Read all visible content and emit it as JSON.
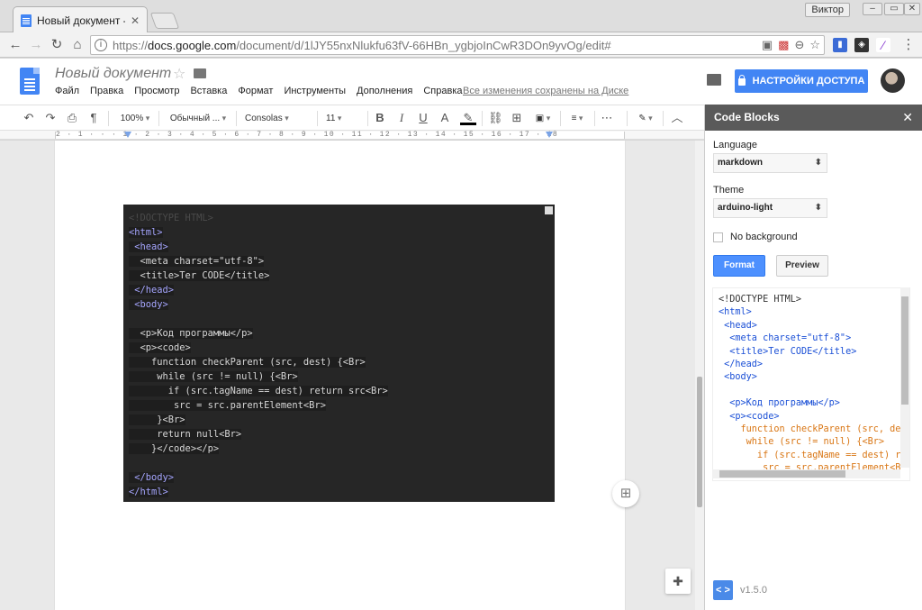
{
  "browser": {
    "tab_title": "Новый документ - ",
    "user_badge": "Виктор",
    "url_scheme": "https://",
    "url_host": "docs.google.com",
    "url_path": "/document/d/1lJY55nxNlukfu63fV-66HBn_ygbjoInCwR3DOn9yvOg/edit#"
  },
  "docs": {
    "title": "Новый документ",
    "menus": [
      "Файл",
      "Правка",
      "Просмотр",
      "Вставка",
      "Формат",
      "Инструменты",
      "Дополнения",
      "Справка"
    ],
    "saved_status": "Все изменения сохранены на Диске",
    "share_label": "НАСТРОЙКИ ДОСТУПА"
  },
  "toolbar": {
    "zoom": "100%",
    "style": "Обычный ...",
    "font": "Consolas",
    "size": "11"
  },
  "ruler": {
    "text": "2 · 1 · · · 1 · 2 · 3 · 4 · 5 · 6 · 7 · 8 · 9 · 10 · 11 · 12 · 13 · 14 · 15 · 16 · 17 · 18"
  },
  "document_code": [
    "<!DOCTYPE HTML>",
    "<html>",
    " <head>",
    "  <meta charset=\"utf-8\">",
    "  <title>Ter CODE</title>",
    " </head>",
    " <body>",
    "",
    "  <p>Код программы</p>",
    "  <p><code>",
    "    function checkParent (src, dest) {<Br>",
    "     while (src != null) {<Br>",
    "       if (src.tagName == dest) return src<Br>",
    "        src = src.parentElement<Br>",
    "     }<Br>",
    "     return null<Br>",
    "    }</code></p>",
    "",
    " </body>",
    "</html>"
  ],
  "panel": {
    "title": "Code Blocks",
    "language_label": "Language",
    "language_value": "markdown",
    "theme_label": "Theme",
    "theme_value": "arduino-light",
    "no_background_label": "No background",
    "format_label": "Format",
    "preview_label": "Preview",
    "version": "v1.5.0",
    "logo_glyph": "< >",
    "preview_code": [
      "<!DOCTYPE HTML>",
      "<html>",
      " <head>",
      "  <meta charset=\"utf-8\">",
      "  <title>Ter CODE</title>",
      " </head>",
      " <body>",
      "",
      "  <p>Код программы</p>",
      "  <p><code>",
      "    function checkParent (src, de",
      "     while (src != null) {<Br>",
      "       if (src.tagName == dest) r",
      "        src = src.parentElement<B"
    ]
  },
  "colors": {
    "accent": "#4285f4",
    "code_bg": "#262626",
    "panel_header": "#5a5a5a"
  }
}
